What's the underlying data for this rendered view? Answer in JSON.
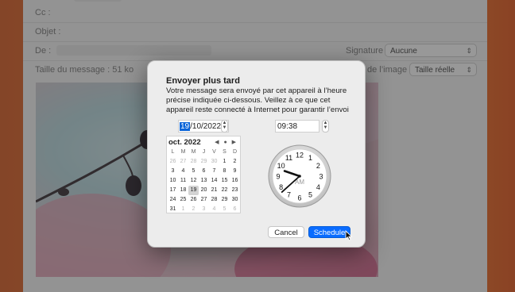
{
  "mail": {
    "cc_label": "Cc :",
    "subject_label": "Objet :",
    "from_label": "De :",
    "signature_label": "Signature :",
    "signature_value": "Aucune",
    "message_size": "Taille du message : 51 ko",
    "image_size_label": "de l’image :",
    "image_size_value": "Taille réelle"
  },
  "dialog": {
    "title": "Envoyer plus tard",
    "description": "Votre message sera envoyé par cet appareil à l’heure précise indiquée ci-dessous. Veillez à ce que cet appareil reste connecté à Internet pour garantir l’envoi",
    "date_day": "19",
    "date_rest": "/10/2022",
    "time": "09:38",
    "calendar": {
      "month": "oct. 2022",
      "nav": "◀ ● ▶",
      "weekdays": [
        "L",
        "M",
        "M",
        "J",
        "V",
        "S",
        "D"
      ],
      "weeks": [
        [
          "26",
          "27",
          "28",
          "29",
          "30",
          "1",
          "2"
        ],
        [
          "3",
          "4",
          "5",
          "6",
          "7",
          "8",
          "9"
        ],
        [
          "10",
          "11",
          "12",
          "13",
          "14",
          "15",
          "16"
        ],
        [
          "17",
          "18",
          "19",
          "20",
          "21",
          "22",
          "23"
        ],
        [
          "24",
          "25",
          "26",
          "27",
          "28",
          "29",
          "30"
        ],
        [
          "31",
          "1",
          "2",
          "3",
          "4",
          "5",
          "6"
        ]
      ],
      "selected": "19"
    },
    "clock": {
      "numbers": [
        "12",
        "1",
        "2",
        "3",
        "4",
        "5",
        "6",
        "7",
        "8",
        "9",
        "10",
        "11"
      ],
      "period": "AM",
      "hour": 9,
      "minute": 38
    },
    "cancel_label": "Cancel",
    "schedule_label": "Schedule"
  },
  "colors": {
    "accent": "#0a6cff",
    "selection": "#0a64d8"
  },
  "icons": [
    "stepper-icon",
    "chevron-updown-icon",
    "pointer-cursor-icon"
  ]
}
